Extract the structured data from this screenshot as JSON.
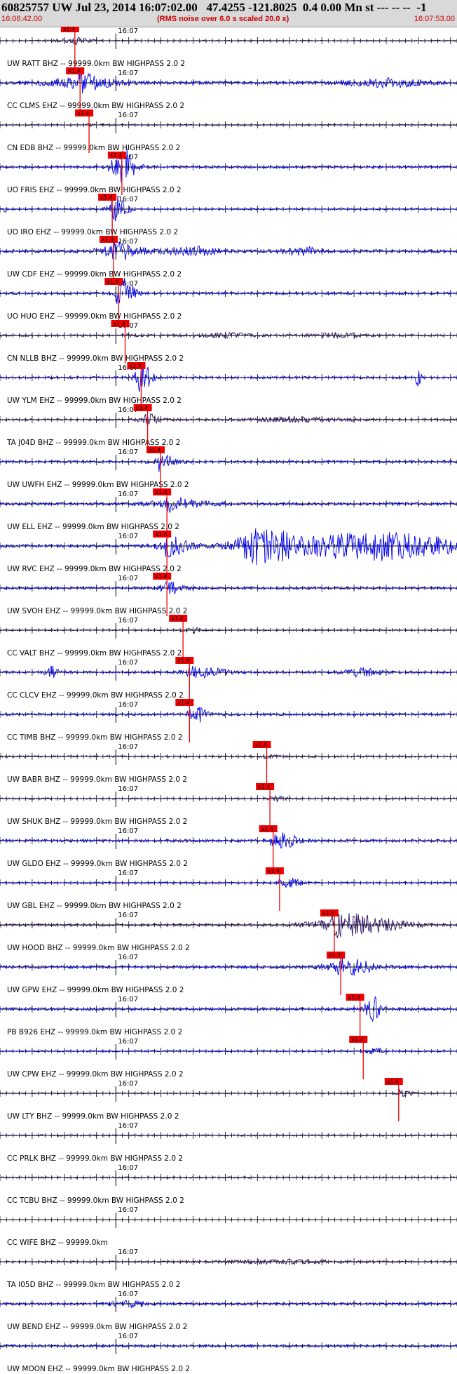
{
  "header": {
    "title": "60825757 UW Jul 23, 2014 16:07:02.00   47.4255 -121.8025  0.4 0.00 Mn st --- -- --  -1",
    "start_time": "16:06:42.00",
    "note": "(RMS noise over 6.0 s scaled 20.0 x)",
    "end_time": "16:07:53.00"
  },
  "colors": {
    "trace_blue": "#0000ee",
    "trace_dark": "#2a1060",
    "pick_red": "#ee0000",
    "header_bg": "#d9d9d9"
  },
  "chart_data": {
    "type": "line",
    "x_start": "16:06:42.00",
    "x_end": "16:07:53.00",
    "duration_s": 71,
    "minute_tick_time": "16:07",
    "minute_tick_s": 18,
    "pick_label": "x1.4",
    "traces": [
      {
        "label": "UW RATT BHZ -- 99999.0km BW  HIGHPASS  2.0  2",
        "color": "dark",
        "pick_s": 11.2,
        "amp": 0.4,
        "events": [
          [
            11.3,
            3,
            2.5
          ]
        ]
      },
      {
        "label": "CC CLMS EHZ -- 99999.0km BW  HIGHPASS  2.0  2",
        "color": "blue",
        "pick_s": 12.0,
        "amp": 1.0,
        "events": [
          [
            12.5,
            6,
            3
          ],
          [
            60,
            6,
            2.5
          ]
        ]
      },
      {
        "label": "CN EDB BHZ -- 99999.0km BW  HIGHPASS  2.0  2",
        "color": "dark",
        "pick_s": 13.4,
        "amp": 0.4,
        "events": []
      },
      {
        "label": "UO FRIS EHZ -- 99999.0km BW  HIGHPASS  2.0  2",
        "color": "blue",
        "pick_s": 18.5,
        "amp": 0.8,
        "events": [
          [
            19.0,
            2,
            9
          ]
        ]
      },
      {
        "label": "UO IRO EHZ -- 99999.0km BW  HIGHPASS  2.0  2",
        "color": "blue",
        "pick_s": 17.0,
        "amp": 0.5,
        "events": [
          [
            18.3,
            1.6,
            10
          ],
          [
            0.8,
            0.3,
            4
          ]
        ]
      },
      {
        "label": "UW CDF EHZ -- 99999.0km BW  HIGHPASS  2.0  2",
        "color": "blue",
        "pick_s": 17.2,
        "amp": 1.0,
        "events": [
          [
            18.5,
            4,
            3
          ],
          [
            30,
            4,
            2.5
          ],
          [
            47,
            3,
            2.5
          ]
        ]
      },
      {
        "label": "UO HUO EHZ -- 99999.0km BW  HIGHPASS  2.0  2",
        "color": "blue",
        "pick_s": 18.0,
        "amp": 0.8,
        "events": [
          [
            19.5,
            1.5,
            7
          ]
        ]
      },
      {
        "label": "CN NLLB BHZ -- 99999.0km BW  HIGHPASS  2.0  2",
        "color": "dark",
        "pick_s": 19.0,
        "amp": 0.6,
        "events": [
          [
            35,
            5,
            2.2
          ],
          [
            52,
            5,
            2
          ]
        ]
      },
      {
        "label": "UW YLM EHZ -- 99999.0km BW  HIGHPASS  2.0  2",
        "color": "blue",
        "pick_s": 21.5,
        "amp": 0.7,
        "events": [
          [
            22,
            1.5,
            8
          ],
          [
            65,
            0.5,
            8
          ]
        ]
      },
      {
        "label": "TA J04D BHZ -- 99999.0km BW  HIGHPASS  2.0  2",
        "color": "dark",
        "pick_s": 22.5,
        "amp": 0.6,
        "events": [
          [
            23,
            2,
            3
          ],
          [
            46,
            8,
            2.5
          ]
        ]
      },
      {
        "label": "UW UWFH EHZ -- 99999.0km BW  HIGHPASS  2.0  2",
        "color": "blue",
        "pick_s": 24.5,
        "amp": 0.8,
        "events": [
          [
            25.5,
            2,
            3
          ]
        ]
      },
      {
        "label": "UW ELL EHZ -- 99999.0km BW  HIGHPASS  2.0  2",
        "color": "blue",
        "pick_s": 25.5,
        "amp": 0.9,
        "events": [
          [
            28,
            5,
            2.5
          ]
        ]
      },
      {
        "label": "UW RVC EHZ -- 99999.0km BW  HIGHPASS  2.0  2",
        "color": "blue",
        "pick_s": 25.5,
        "amp": 0.9,
        "events": [
          [
            27,
            3,
            3
          ],
          [
            40,
            4,
            4
          ],
          [
            58,
            14,
            10
          ]
        ]
      },
      {
        "label": "UW SVOH EHZ -- 99999.0km BW  HIGHPASS  2.0  2",
        "color": "blue",
        "pick_s": 25.5,
        "amp": 0.8,
        "events": [
          [
            26.5,
            2,
            2.5
          ]
        ]
      },
      {
        "label": "CC VALT BHZ -- 99999.0km BW  HIGHPASS  2.0  2",
        "color": "dark",
        "pick_s": 28.0,
        "amp": 0.4,
        "events": [
          [
            30,
            1,
            3
          ]
        ]
      },
      {
        "label": "CC CLCV EHZ -- 99999.0km BW  HIGHPASS  2.0  2",
        "color": "blue",
        "pick_s": 29.0,
        "amp": 0.7,
        "events": [
          [
            8,
            1.2,
            5
          ],
          [
            32,
            4,
            3
          ],
          [
            56,
            3,
            4
          ]
        ]
      },
      {
        "label": "CC TIMB BHZ -- 99999.0km BW  HIGHPASS  2.0  2",
        "color": "blue",
        "pick_s": 29.0,
        "amp": 0.8,
        "events": [
          [
            31,
            1.2,
            3.5
          ]
        ]
      },
      {
        "label": "UW BABR BHZ -- 99999.0km BW  HIGHPASS  2.0  2",
        "color": "dark",
        "pick_s": 41.0,
        "amp": 0.6,
        "events": []
      },
      {
        "label": "UW SHUK BHZ -- 99999.0km BW  HIGHPASS  2.0  2",
        "color": "dark",
        "pick_s": 41.5,
        "amp": 0.5,
        "events": [
          [
            43.5,
            1,
            2.5
          ]
        ]
      },
      {
        "label": "UW GLDO EHZ -- 99999.0km BW  HIGHPASS  2.0  2",
        "color": "blue",
        "pick_s": 42.0,
        "amp": 0.9,
        "events": [
          [
            44.5,
            2,
            3
          ]
        ]
      },
      {
        "label": "UW GBL EHZ -- 99999.0km BW  HIGHPASS  2.0  2",
        "color": "blue",
        "pick_s": 43.0,
        "amp": 0.5,
        "events": [
          [
            45,
            2,
            4
          ]
        ]
      },
      {
        "label": "UW HOOD BHZ -- 99999.0km BW  HIGHPASS  2.0  2",
        "color": "dark",
        "pick_s": 51.5,
        "amp": 0.7,
        "events": [
          [
            56,
            7,
            8
          ]
        ]
      },
      {
        "label": "UW GPW EHZ -- 99999.0km BW  HIGHPASS  2.0  2",
        "color": "blue",
        "pick_s": 52.5,
        "amp": 0.9,
        "events": [
          [
            55,
            4,
            4
          ]
        ]
      },
      {
        "label": "PB B926 EHZ -- 99999.0km BW  HIGHPASS  2.0  2",
        "color": "blue",
        "pick_s": 55.5,
        "amp": 0.9,
        "events": [
          [
            58,
            1,
            6
          ]
        ]
      },
      {
        "label": "UW CPW EHZ -- 99999.0km BW  HIGHPASS  2.0  2",
        "color": "blue",
        "pick_s": 56.0,
        "amp": 0.5,
        "events": [
          [
            58.5,
            1,
            3
          ]
        ]
      },
      {
        "label": "UW LTY BHZ -- 99999.0km BW  HIGHPASS  2.0  2",
        "color": "dark",
        "pick_s": 61.5,
        "amp": 0.4,
        "events": [
          [
            63,
            1.2,
            4
          ]
        ]
      },
      {
        "label": "CC PRLK BHZ -- 99999.0km BW  HIGHPASS  2.0  2",
        "color": "dark",
        "pick_s": null,
        "amp": 0.5,
        "events": []
      },
      {
        "label": "CC TCBU BHZ -- 99999.0km BW  HIGHPASS  2.0  2",
        "color": "dark",
        "pick_s": null,
        "amp": 0.5,
        "events": []
      },
      {
        "label": "CC WIFE BHZ -- 99999.0km",
        "color": "none",
        "pick_s": null,
        "amp": 0,
        "events": []
      },
      {
        "label": "TA I05D BHZ -- 99999.0km BW  HIGHPASS  2.0  2",
        "color": "dark",
        "pick_s": null,
        "amp": 0.5,
        "events": [
          [
            44,
            10,
            2.5
          ]
        ]
      },
      {
        "label": "UW BEND EHZ -- 99999.0km BW  HIGHPASS  2.0  2",
        "color": "blue",
        "pick_s": null,
        "amp": 0.8,
        "events": [
          [
            20,
            3,
            2
          ]
        ]
      },
      {
        "label": "UW MOON EHZ -- 99999.0km BW  HIGHPASS  2.0  2",
        "color": "blue",
        "pick_s": null,
        "amp": 0.8,
        "events": []
      }
    ]
  }
}
